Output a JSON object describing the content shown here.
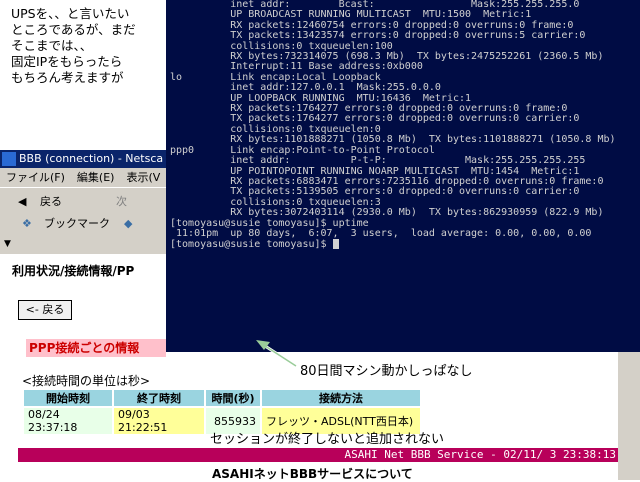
{
  "memo": {
    "lines": [
      "UPSを、、と言いたい",
      "ところであるが、まだ",
      "そこまでは、、",
      "固定IPをもらったら",
      "もちろん考えますが"
    ]
  },
  "browser": {
    "title": "BBB (connection) - Netsca",
    "menu": [
      "ファイル(F)",
      "編集(E)",
      "表示(V"
    ],
    "back_label": "戻る",
    "forward_label": "次",
    "bookmark_label": "ブックマーク",
    "page_heading": "利用状況/接続情報/PP",
    "back_button": "<- 戻る",
    "ppp_heading": "PPP接続ごとの情報",
    "unit_note": "<接続時間の単位は秒>",
    "table": {
      "headers": [
        "開始時刻",
        "終了時刻",
        "時間(秒)",
        "接続方法"
      ],
      "row": [
        "08/24 23:37:18",
        "09/03 21:22:51",
        "855933",
        "フレッツ・ADSL(NTT西日本)"
      ]
    },
    "session_note": "セッションが終了しないと追加されない",
    "banner": "ASAHI Net BBB Service - 02/11/ 3 23:38:13",
    "about_link": "ASAHIネットBBBサービスについて"
  },
  "terminal": {
    "lines": [
      "          inet addr:        Bcast:                Mask:255.255.255.0",
      "          UP BROADCAST RUNNING MULTICAST  MTU:1500  Metric:1",
      "          RX packets:12460754 errors:0 dropped:0 overruns:0 frame:0",
      "          TX packets:13423574 errors:0 dropped:0 overruns:5 carrier:0",
      "          collisions:0 txqueuelen:100",
      "          RX bytes:732314075 (698.3 Mb)  TX bytes:2475252261 (2360.5 Mb)",
      "          Interrupt:11 Base address:0xb000",
      "",
      "lo        Link encap:Local Loopback",
      "          inet addr:127.0.0.1  Mask:255.0.0.0",
      "          UP LOOPBACK RUNNING  MTU:16436  Metric:1",
      "          RX packets:1764277 errors:0 dropped:0 overruns:0 frame:0",
      "          TX packets:1764277 errors:0 dropped:0 overruns:0 carrier:0",
      "          collisions:0 txqueuelen:0",
      "          RX bytes:1101888271 (1050.8 Mb)  TX bytes:1101888271 (1050.8 Mb)",
      "",
      "ppp0      Link encap:Point-to-Point Protocol",
      "          inet addr:          P-t-P:             Mask:255.255.255.255",
      "          UP POINTOPOINT RUNNING NOARP MULTICAST  MTU:1454  Metric:1",
      "          RX packets:6883471 errors:7235116 dropped:0 overruns:0 frame:0",
      "          TX packets:5139505 errors:0 dropped:0 overruns:0 carrier:0",
      "          collisions:0 txqueuelen:3",
      "          RX bytes:3072403114 (2930.0 Mb)  TX bytes:862930959 (822.9 Mb)",
      "",
      "[tomoyasu@susie tomoyasu]$ uptime",
      " 11:01pm  up 80 days,  6:07,  3 users,  load average: 0.00, 0.00, 0.00",
      "[tomoyasu@susie tomoyasu]$ "
    ]
  },
  "annotation": "80日間マシン動かしっぱなし"
}
